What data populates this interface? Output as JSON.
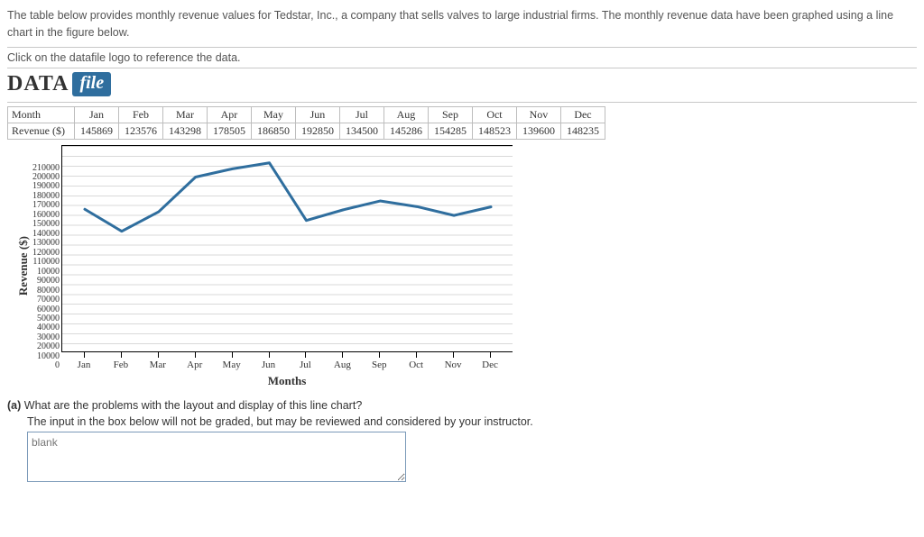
{
  "intro": "The table below provides monthly revenue values for Tedstar, Inc., a company that sells valves to large industrial firms. The monthly revenue data have been graphed using a line chart in the figure below.",
  "click_line": "Click on the datafile logo to reference the data.",
  "datafile": {
    "word": "DATA",
    "button": "file"
  },
  "table": {
    "row1_label": "Month",
    "row2_label": "Revenue ($)",
    "months": [
      "Jan",
      "Feb",
      "Mar",
      "Apr",
      "May",
      "Jun",
      "Jul",
      "Aug",
      "Sep",
      "Oct",
      "Nov",
      "Dec"
    ],
    "values": [
      "145869",
      "123576",
      "143298",
      "178505",
      "186850",
      "192850",
      "134500",
      "145286",
      "154285",
      "148523",
      "139600",
      "148235"
    ]
  },
  "chart_data": {
    "type": "line",
    "title": "",
    "xlabel": "Months",
    "ylabel": "Revenue ($)",
    "categories": [
      "Jan",
      "Feb",
      "Mar",
      "Apr",
      "May",
      "Jun",
      "Jul",
      "Aug",
      "Sep",
      "Oct",
      "Nov",
      "Dec"
    ],
    "values": [
      145869,
      123576,
      143298,
      178505,
      186850,
      192850,
      134500,
      145286,
      154285,
      148523,
      139600,
      148235
    ],
    "ylim": [
      0,
      210000
    ],
    "yticks": [
      210000,
      200000,
      190000,
      180000,
      170000,
      160000,
      150000,
      140000,
      130000,
      120000,
      110000,
      10000,
      90000,
      80000,
      70000,
      60000,
      50000,
      40000,
      30000,
      20000,
      10000,
      0
    ],
    "line_color": "#2f6e9e",
    "grid": true
  },
  "question": {
    "tag": "(a)",
    "text": "What are the problems with the layout and display of this line chart?",
    "note": "The input in the box below will not be graded, but may be reviewed and considered by your instructor.",
    "placeholder": "blank"
  }
}
